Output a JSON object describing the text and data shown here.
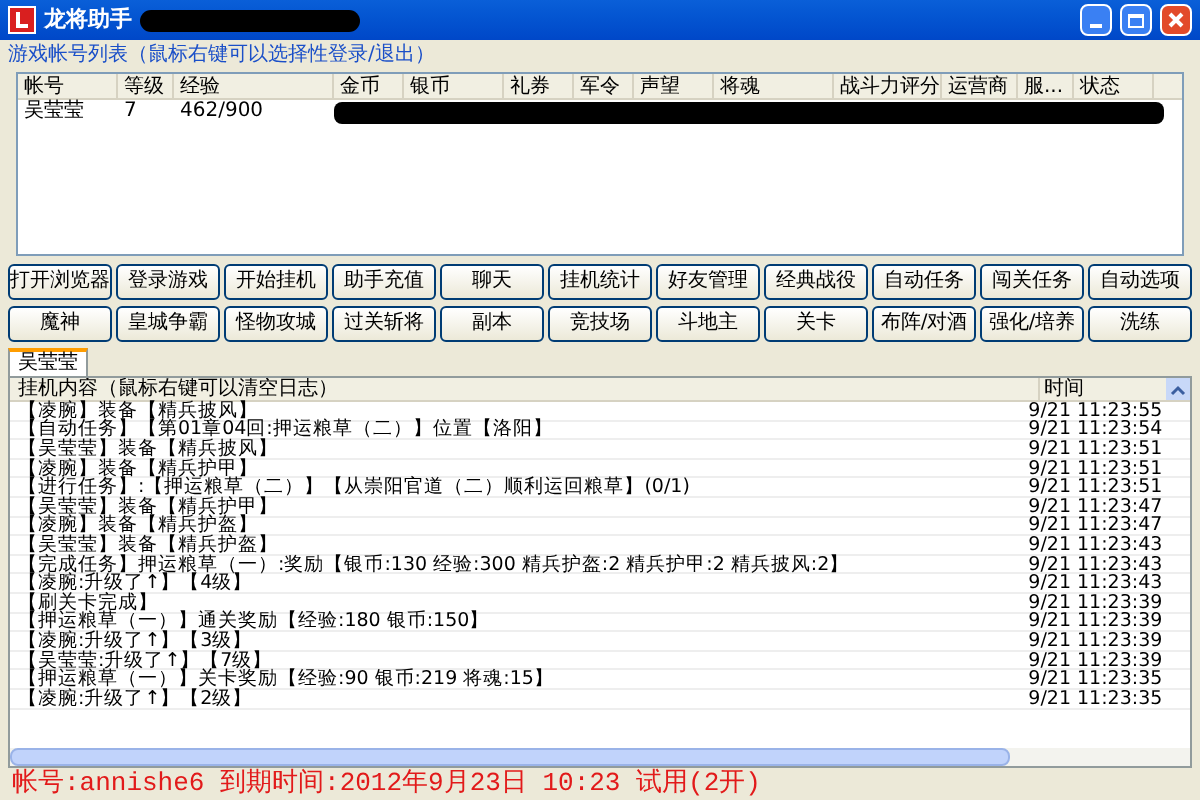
{
  "window": {
    "title": "龙将助手"
  },
  "account_list": {
    "label": "游戏帐号列表（鼠标右键可以选择性登录/退出）",
    "columns": [
      "帐号",
      "等级",
      "经验",
      "金币",
      "银币",
      "礼券",
      "军令",
      "声望",
      "将魂",
      "战斗力评分",
      "运营商",
      "服...",
      "状态"
    ],
    "rows": [
      {
        "cells": [
          "吴莹莹",
          "7",
          "462/900"
        ],
        "selected": false
      }
    ]
  },
  "buttons": [
    [
      "打开浏览器",
      "登录游戏",
      "开始挂机",
      "助手充值",
      "聊天",
      "挂机统计",
      "好友管理",
      "经典战役",
      "自动任务",
      "闯关任务",
      "自动选项"
    ],
    [
      "魔神",
      "皇城争霸",
      "怪物攻城",
      "过关斩将",
      "副本",
      "竞技场",
      "斗地主",
      "关卡",
      "布阵/对酒",
      "强化/培养",
      "洗练"
    ]
  ],
  "tabs": [
    {
      "label": "吴莹莹",
      "selected": true
    }
  ],
  "log": {
    "columns": [
      "挂机内容（鼠标右键可以清空日志）",
      "时间"
    ],
    "rows": [
      [
        "【凌腕】装备【精兵披风】",
        "9/21 11:23:55"
      ],
      [
        "【自动任务】【第01章04回:押运粮草（二）】位置【洛阳】",
        "9/21 11:23:54"
      ],
      [
        "【吴莹莹】装备【精兵披风】",
        "9/21 11:23:51"
      ],
      [
        "【凌腕】装备【精兵护甲】",
        "9/21 11:23:51"
      ],
      [
        "【进行任务】:【押运粮草（二）】【从崇阳官道（二）顺利运回粮草】(0/1)",
        "9/21 11:23:51"
      ],
      [
        "【吴莹莹】装备【精兵护甲】",
        "9/21 11:23:47"
      ],
      [
        "【凌腕】装备【精兵护盔】",
        "9/21 11:23:47"
      ],
      [
        "【吴莹莹】装备【精兵护盔】",
        "9/21 11:23:43"
      ],
      [
        "【完成任务】押运粮草（一）:奖励【银币:130 经验:300 精兵护盔:2 精兵护甲:2 精兵披风:2】",
        "9/21 11:23:43"
      ],
      [
        "【凌腕:升级了↑】【4级】",
        "9/21 11:23:43"
      ],
      [
        "【刷关卡完成】",
        "9/21 11:23:39"
      ],
      [
        "【押运粮草（一）】通关奖励【经验:180 银币:150】",
        "9/21 11:23:39"
      ],
      [
        "【凌腕:升级了↑】【3级】",
        "9/21 11:23:39"
      ],
      [
        "【吴莹莹:升级了↑】【7级】",
        "9/21 11:23:39"
      ],
      [
        "【押运粮草（一）】关卡奖励【经验:90 银币:219 将魂:15】",
        "9/21 11:23:35"
      ],
      [
        "【凌腕:升级了↑】【2级】",
        "9/21 11:23:35"
      ]
    ]
  },
  "status_bar": {
    "text": "帐号:annishe6 到期时间:2012年9月23日 10:23 试用(2开)"
  }
}
